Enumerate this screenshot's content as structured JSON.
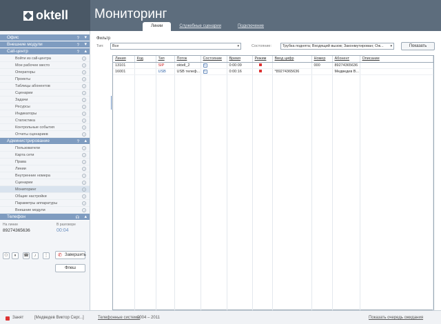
{
  "app": {
    "logo_text": "oktell",
    "page_title": "Мониторинг"
  },
  "tabs": [
    {
      "label": "Линии",
      "active": true
    },
    {
      "label": "Служебные сценарии",
      "active": false
    },
    {
      "label": "Подключение",
      "active": false
    }
  ],
  "sidebar": {
    "groups": [
      {
        "label": "Офис",
        "expanded": false,
        "items": []
      },
      {
        "label": "Внешние модули",
        "expanded": false,
        "items": []
      },
      {
        "label": "Call-центр",
        "expanded": true,
        "items": [
          "Войти из call-центра",
          "Мое рабочее место",
          "Операторы",
          "Проекты",
          "Таблицы абонентов",
          "Сценарии",
          "Задачи",
          "Ресурсы",
          "Индикаторы",
          "Статистика",
          "Контрольные события",
          "Отчеты сценариев"
        ]
      },
      {
        "label": "Администрирование",
        "expanded": true,
        "items": [
          "Пользователи",
          "Карта сети",
          "Права",
          "Линии",
          "Внутренние номера",
          "Сценарии",
          "Мониторинг",
          "Общие настройки",
          "Параметры аппаратуры",
          "Внешние модули"
        ]
      }
    ],
    "active_item": "Мониторинг",
    "phone": {
      "header": "Телефон",
      "line_label": "На линии",
      "line_number": "89274365636",
      "talk_label": "В разговоре",
      "talk_time": "00:04",
      "hangup_label": "Завершить",
      "flash_label": "Флеш"
    }
  },
  "filter": {
    "title": "Фильтр",
    "type_label": "Тип:",
    "type_value": "Все",
    "state_label": "Состояние:",
    "state_value": "Трубка поднята; Входящий вызов; Законмутирован; Ож...",
    "show_label": "Показать"
  },
  "table": {
    "columns": [
      "Линия",
      "Код",
      "Тип",
      "Поток",
      "Состояние",
      "Время",
      "Режим",
      "Ввод цифр",
      "Номер",
      "Абонент",
      "Описание"
    ],
    "rows": [
      {
        "line": "13101",
        "code": "",
        "type": "SIP",
        "stream": "oktell_2",
        "state": "state-icon",
        "time": "0:00:09",
        "mode": "red",
        "digits": "",
        "number": "000",
        "subscriber": "89274365636",
        "description": ""
      },
      {
        "line": "16001",
        "code": "",
        "type": "USB",
        "stream": "USB телеф...",
        "state": "state-icon",
        "time": "0:00:16",
        "mode": "red",
        "digits": "*89274365636",
        "number": "",
        "subscriber": "Медведев В...",
        "description": ""
      }
    ]
  },
  "statusbar": {
    "status": "Занят",
    "user": "[Медведев Виктор Серг...]",
    "company_link": "Телефонные системы",
    "years": "2004 – 2011",
    "queue_link": "Показать очередь ожидания"
  },
  "colors": {
    "header_bg": "#5d6d7d",
    "group_hdr": "#7f9cc0",
    "accent": "#6b8fbf",
    "busy": "#dd3333"
  }
}
